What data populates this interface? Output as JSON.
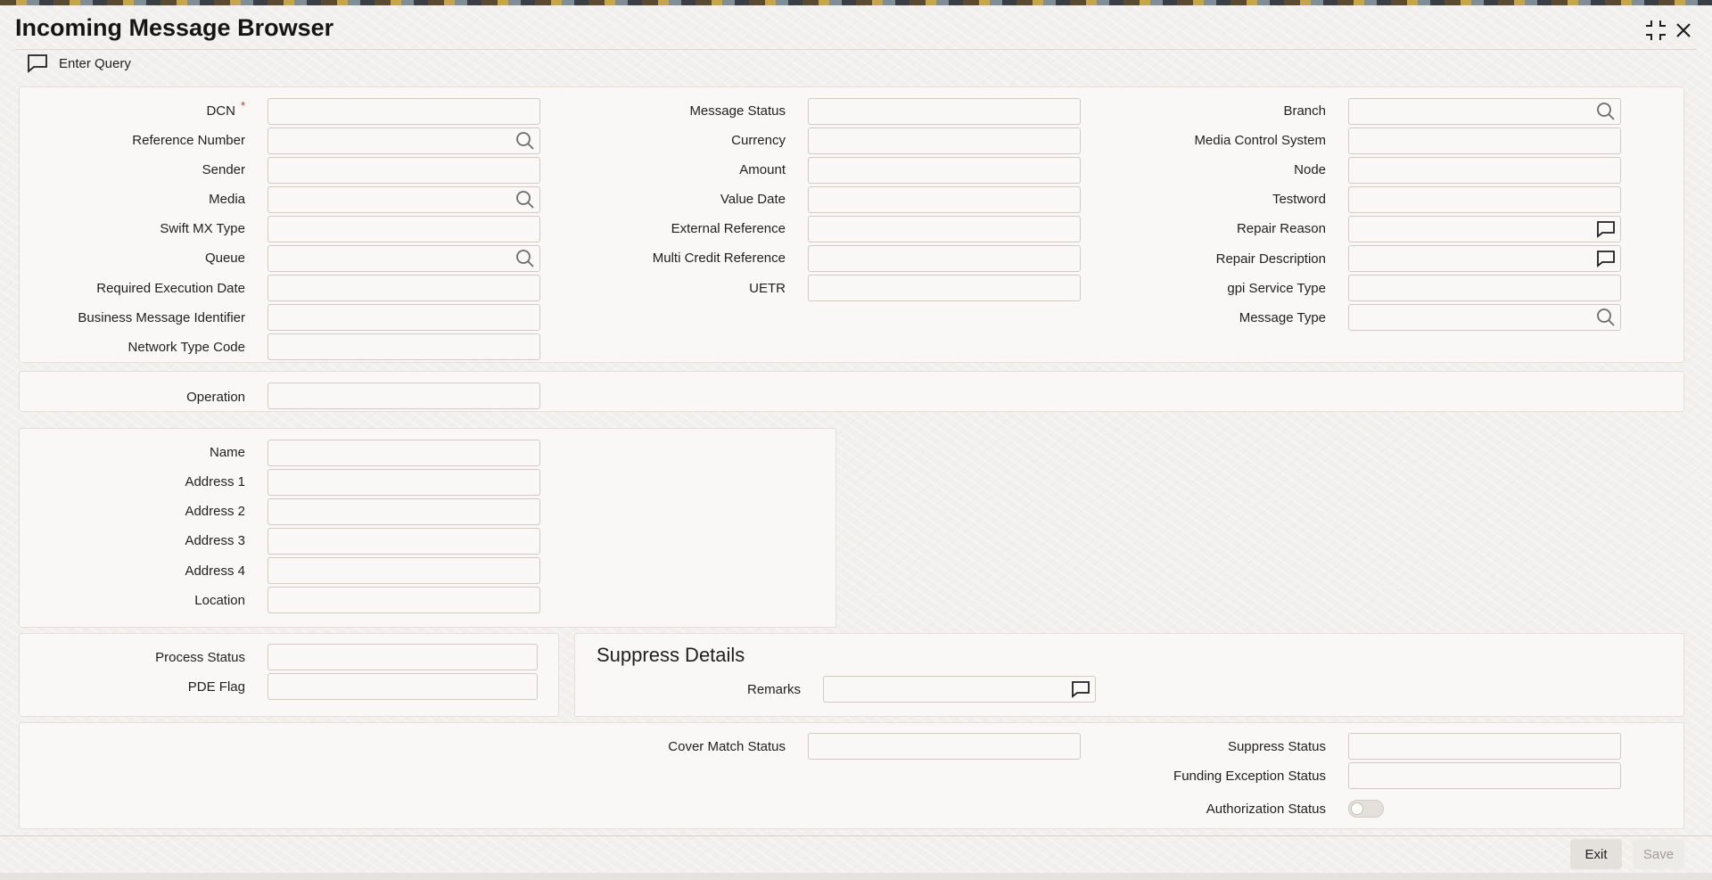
{
  "page": {
    "title": "Incoming Message Browser"
  },
  "toolbar": {
    "enter_query": "Enter Query"
  },
  "main": {
    "col1": {
      "dcn": "DCN",
      "required_marker": "*",
      "reference_number": "Reference Number",
      "sender": "Sender",
      "media": "Media",
      "swift_mx_type": "Swift MX Type",
      "queue": "Queue",
      "required_execution_date": "Required Execution Date",
      "business_message_identifier": "Business Message Identifier",
      "network_type_code": "Network Type Code"
    },
    "col2": {
      "message_status": "Message Status",
      "currency": "Currency",
      "amount": "Amount",
      "value_date": "Value Date",
      "external_reference": "External Reference",
      "multi_credit_reference": "Multi Credit Reference",
      "uetr": "UETR"
    },
    "col3": {
      "branch": "Branch",
      "media_control_system": "Media Control System",
      "node": "Node",
      "testword": "Testword",
      "repair_reason": "Repair Reason",
      "repair_description": "Repair Description",
      "gpi_service_type": "gpi Service Type",
      "message_type": "Message Type"
    }
  },
  "operation": {
    "label": "Operation"
  },
  "address": {
    "name": "Name",
    "address1": "Address 1",
    "address2": "Address 2",
    "address3": "Address 3",
    "address4": "Address 4",
    "location": "Location"
  },
  "process": {
    "process_status": "Process Status",
    "pde_flag": "PDE Flag"
  },
  "suppress": {
    "title": "Suppress Details",
    "remarks": "Remarks"
  },
  "status": {
    "cover_match_status": "Cover Match Status",
    "suppress_status": "Suppress Status",
    "funding_exception_status": "Funding Exception Status",
    "authorization_status": "Authorization Status"
  },
  "footer": {
    "exit_label": "Exit",
    "save_label": "Save"
  },
  "icons": {
    "query": "chat-bubble-icon",
    "lookup": "search-icon",
    "text_editor": "chat-bubble-icon",
    "maximize": "compress-icon",
    "close": "close-icon"
  }
}
